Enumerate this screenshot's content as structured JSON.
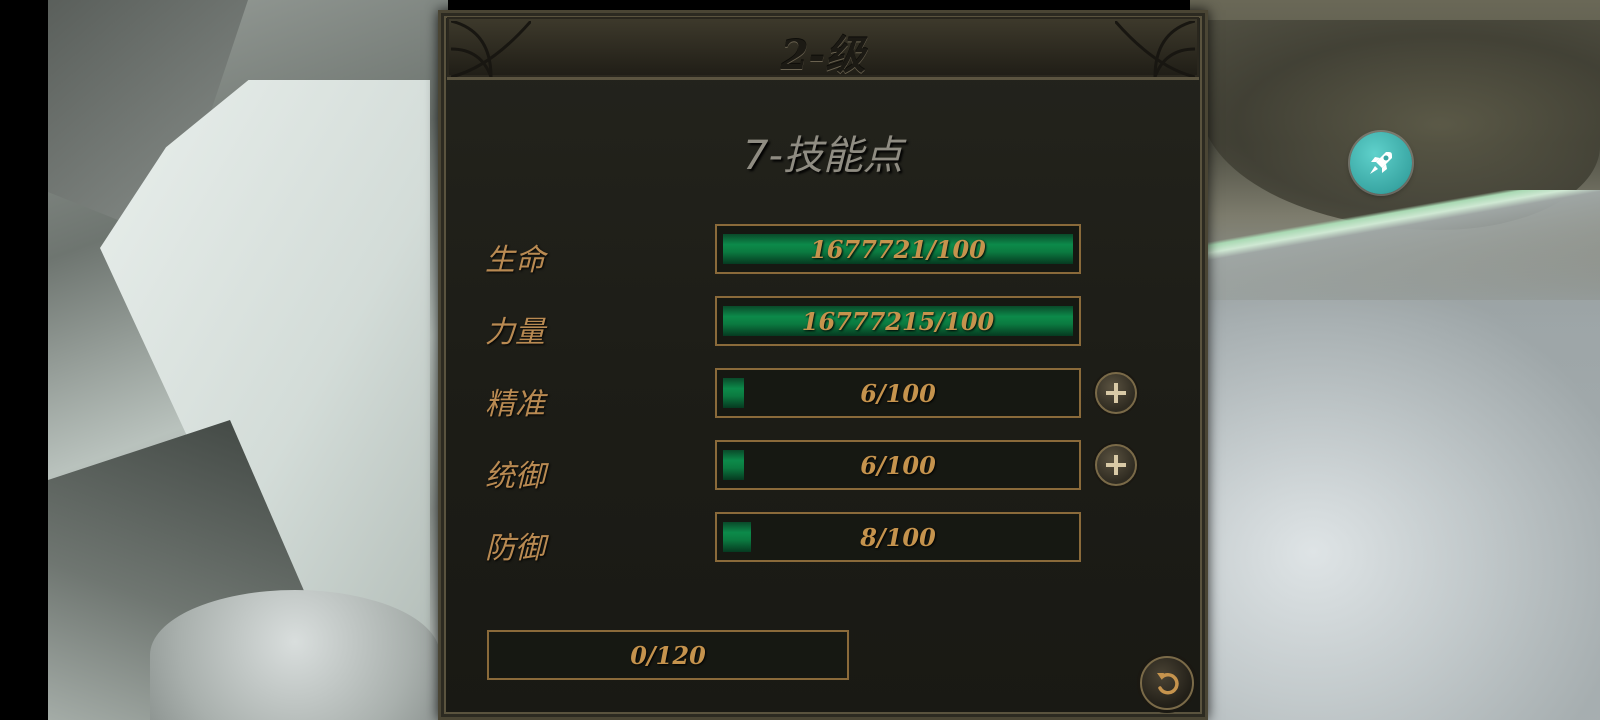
{
  "panel": {
    "level_title": "2-级",
    "skill_points": "7-技能点"
  },
  "stats": [
    {
      "label": "生命",
      "value": "1677721/100",
      "fill_fraction": 1.0,
      "has_plus": false
    },
    {
      "label": "力量",
      "value": "16777215/100",
      "fill_fraction": 1.0,
      "has_plus": false
    },
    {
      "label": "精准",
      "value": "6/100",
      "fill_fraction": 0.06,
      "has_plus": true
    },
    {
      "label": "统御",
      "value": "6/100",
      "fill_fraction": 0.06,
      "has_plus": true
    },
    {
      "label": "防御",
      "value": "8/100",
      "fill_fraction": 0.08,
      "has_plus": false
    }
  ],
  "experience": {
    "value": "0/120"
  },
  "icons": {
    "rocket": "rocket-icon",
    "plus": "plus-icon",
    "back": "undo-arrow-icon"
  },
  "colors": {
    "label": "#b98a52",
    "bar_fill": "#0c8a4a",
    "bar_border": "#8a6a3a",
    "rocket_button": "#3aa7a4"
  }
}
